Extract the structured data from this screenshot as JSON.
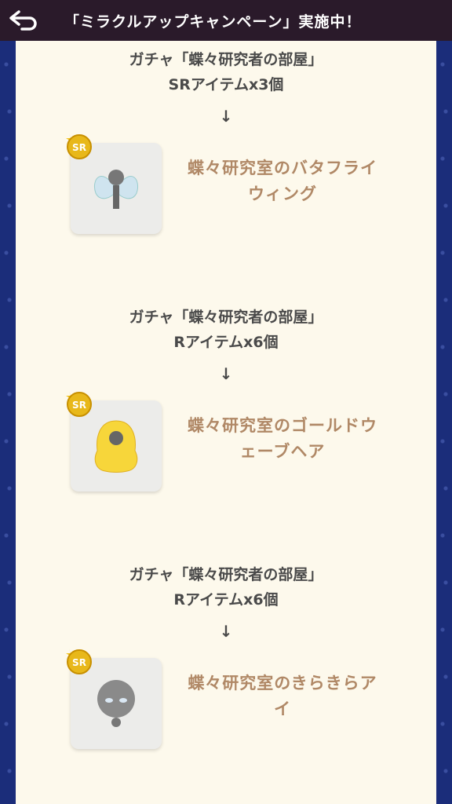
{
  "header": {
    "title": "「ミラクルアップキャンペーン」実施中！",
    "back_icon": "back-arrow-icon"
  },
  "colors": {
    "header_bg": "#2a1a2a",
    "panel_bg": "#fdf9ec",
    "item_name": "#b08866",
    "text": "#4a4a4a",
    "border": "#1b2d7a"
  },
  "sections": [
    {
      "gacha": "ガチャ「蝶々研究者の部屋」",
      "reward": "SRアイテムx3個",
      "arrow": "↓",
      "badge": "SR",
      "item_name_line1": "蝶々研究室のバタフライ",
      "item_name_line2": "ウィング"
    },
    {
      "gacha": "ガチャ「蝶々研究者の部屋」",
      "reward": "Rアイテムx6個",
      "arrow": "↓",
      "badge": "SR",
      "item_name_line1": "蝶々研究室のゴールドウ",
      "item_name_line2": "ェーブヘア"
    },
    {
      "gacha": "ガチャ「蝶々研究者の部屋」",
      "reward": "Rアイテムx6個",
      "arrow": "↓",
      "badge": "SR",
      "item_name_line1": "蝶々研究室のきらきらア",
      "item_name_line2": "イ"
    }
  ]
}
